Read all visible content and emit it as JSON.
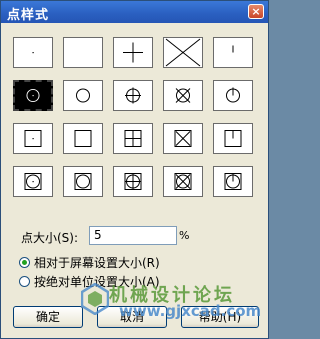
{
  "window": {
    "title": "点样式",
    "close_glyph": "×"
  },
  "styles": {
    "selected_index": 5,
    "rows": [
      [
        "dot",
        "none",
        "plus",
        "cross",
        "tick"
      ],
      [
        "circle-dot",
        "circle",
        "circle-plus",
        "circle-cross",
        "circle-tick"
      ],
      [
        "square-dot",
        "square",
        "square-plus",
        "square-cross",
        "square-tick"
      ],
      [
        "square-circle-dot",
        "square-circle",
        "square-circle-plus",
        "square-circle-cross",
        "square-circle-tick"
      ]
    ]
  },
  "size": {
    "label": "点大小(S):",
    "value": "5",
    "unit": "%"
  },
  "mode": {
    "options": [
      {
        "label": "相对于屏幕设置大小(R)",
        "checked": true
      },
      {
        "label": "按绝对单位设置大小(A)",
        "checked": false
      }
    ]
  },
  "buttons": {
    "ok": "确定",
    "cancel": "取消",
    "help": "帮助(H)"
  },
  "watermark": {
    "text": "机械设计论坛",
    "url": "www.gjxcad.com"
  }
}
